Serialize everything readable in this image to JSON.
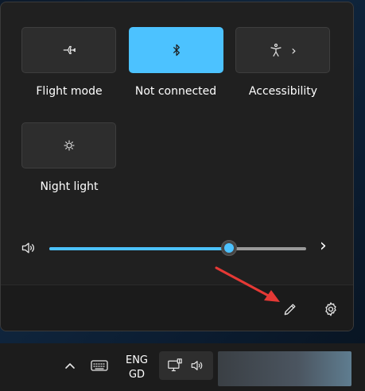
{
  "quick_settings": {
    "tiles": [
      {
        "label": "Flight mode",
        "icon": "airplane-icon",
        "active": false
      },
      {
        "label": "Not connected",
        "icon": "bluetooth-icon",
        "active": true
      },
      {
        "label": "Accessibility",
        "icon": "accessibility-icon",
        "active": false,
        "has_chevron": true
      },
      {
        "label": "Night light",
        "icon": "night-light-icon",
        "active": false
      }
    ],
    "chevron_glyph": "›"
  },
  "volume": {
    "icon": "speaker-icon",
    "level": 70,
    "expand_glyph": "›"
  },
  "footer": {
    "edit_icon": "pencil-icon",
    "settings_icon": "gear-icon"
  },
  "taskbar": {
    "language_line1": "ENG",
    "language_line2": "GD",
    "overflow_icon": "caret-up-icon",
    "keyboard_icon": "keyboard-icon",
    "network_icon": "network-icon",
    "volume_icon": "speaker-icon"
  },
  "colors": {
    "accent": "#4cc2ff",
    "annotation_arrow": "#e53935",
    "panel_bg": "#202020"
  }
}
